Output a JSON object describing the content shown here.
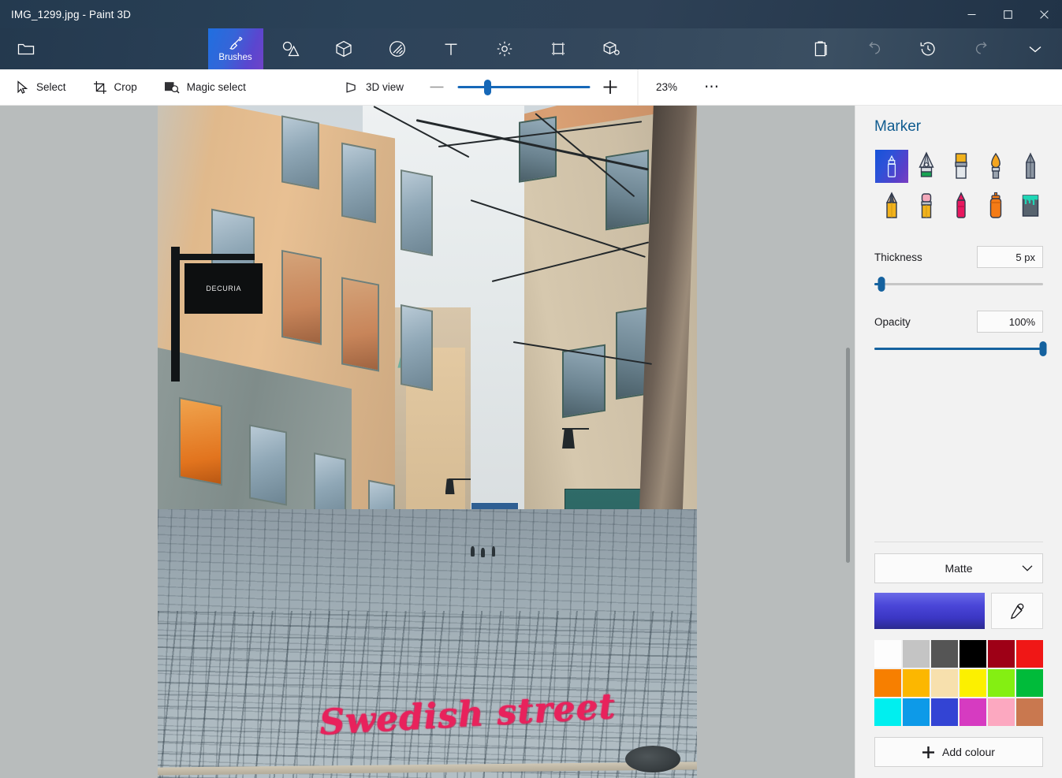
{
  "window": {
    "title": "IMG_1299.jpg - Paint 3D",
    "minimize_label": "─",
    "maximize_label": "□",
    "close_label": "✕"
  },
  "ribbon": {
    "items": [
      {
        "name": "menu",
        "label": "",
        "icon": "folder-icon",
        "active": false
      },
      {
        "name": "brushes",
        "label": "Brushes",
        "icon": "brush-icon",
        "active": true
      },
      {
        "name": "2d-shapes",
        "label": "",
        "icon": "shapes-2d-icon",
        "active": false
      },
      {
        "name": "3d-shapes",
        "label": "",
        "icon": "cube-icon",
        "active": false
      },
      {
        "name": "stickers",
        "label": "",
        "icon": "sticker-icon",
        "active": false
      },
      {
        "name": "text",
        "label": "",
        "icon": "text-icon",
        "active": false
      },
      {
        "name": "effects",
        "label": "",
        "icon": "effects-icon",
        "active": false
      },
      {
        "name": "canvas",
        "label": "",
        "icon": "canvas-icon",
        "active": false
      },
      {
        "name": "3d-library",
        "label": "",
        "icon": "library-3d-icon",
        "active": false
      }
    ],
    "right_items": [
      {
        "name": "paste",
        "icon": "clipboard-icon",
        "dim": false
      },
      {
        "name": "undo",
        "icon": "undo-icon",
        "dim": true
      },
      {
        "name": "history",
        "icon": "history-icon",
        "dim": false
      },
      {
        "name": "redo",
        "icon": "redo-icon",
        "dim": true
      },
      {
        "name": "expand",
        "icon": "chevron-down-icon",
        "dim": false
      }
    ]
  },
  "toolbar": {
    "select_label": "Select",
    "crop_label": "Crop",
    "magic_select_label": "Magic select",
    "view_3d_label": "3D view",
    "zoom_out_label": "−",
    "zoom_in_label": "+",
    "zoom_percent": "23%",
    "zoom_value": 23,
    "more_label": "⋯"
  },
  "panel": {
    "title": "Marker",
    "brushes": [
      {
        "name": "marker",
        "label": "Marker",
        "selected": true
      },
      {
        "name": "calligraphy-pen",
        "label": "Calligraphy pen",
        "selected": false
      },
      {
        "name": "oil-brush",
        "label": "Oil brush",
        "selected": false
      },
      {
        "name": "watercolour",
        "label": "Watercolour",
        "selected": false
      },
      {
        "name": "pixel-pen",
        "label": "Pixel pen",
        "selected": false
      },
      {
        "name": "pencil",
        "label": "Pencil",
        "selected": false
      },
      {
        "name": "eraser",
        "label": "Eraser",
        "selected": false
      },
      {
        "name": "crayon",
        "label": "Crayon",
        "selected": false
      },
      {
        "name": "spray-can",
        "label": "Spray can",
        "selected": false
      },
      {
        "name": "fill",
        "label": "Fill",
        "selected": false
      }
    ],
    "thickness_label": "Thickness",
    "thickness_value": "5 px",
    "thickness_percent": 4,
    "opacity_label": "Opacity",
    "opacity_value": "100%",
    "opacity_percent": 100,
    "material_label": "Matte",
    "current_colour": "#4a46d8",
    "eyedropper_name": "eyedropper-icon",
    "swatches": [
      "#fdfdfd",
      "#c4c4c4",
      "#555555",
      "#000000",
      "#9e0016",
      "#f01716",
      "#f77f00",
      "#fcb700",
      "#f7e0ad",
      "#fcf000",
      "#84ef12",
      "#00bb3a",
      "#00efef",
      "#0d9ae8",
      "#3344d4",
      "#d63bc1",
      "#fca8c0",
      "#c9784f"
    ],
    "add_colour_label": "Add colour"
  },
  "canvas": {
    "sign_text": "DECURIA",
    "handwriting_text": "Swedish street",
    "handwriting_colour": "#e8225c"
  }
}
